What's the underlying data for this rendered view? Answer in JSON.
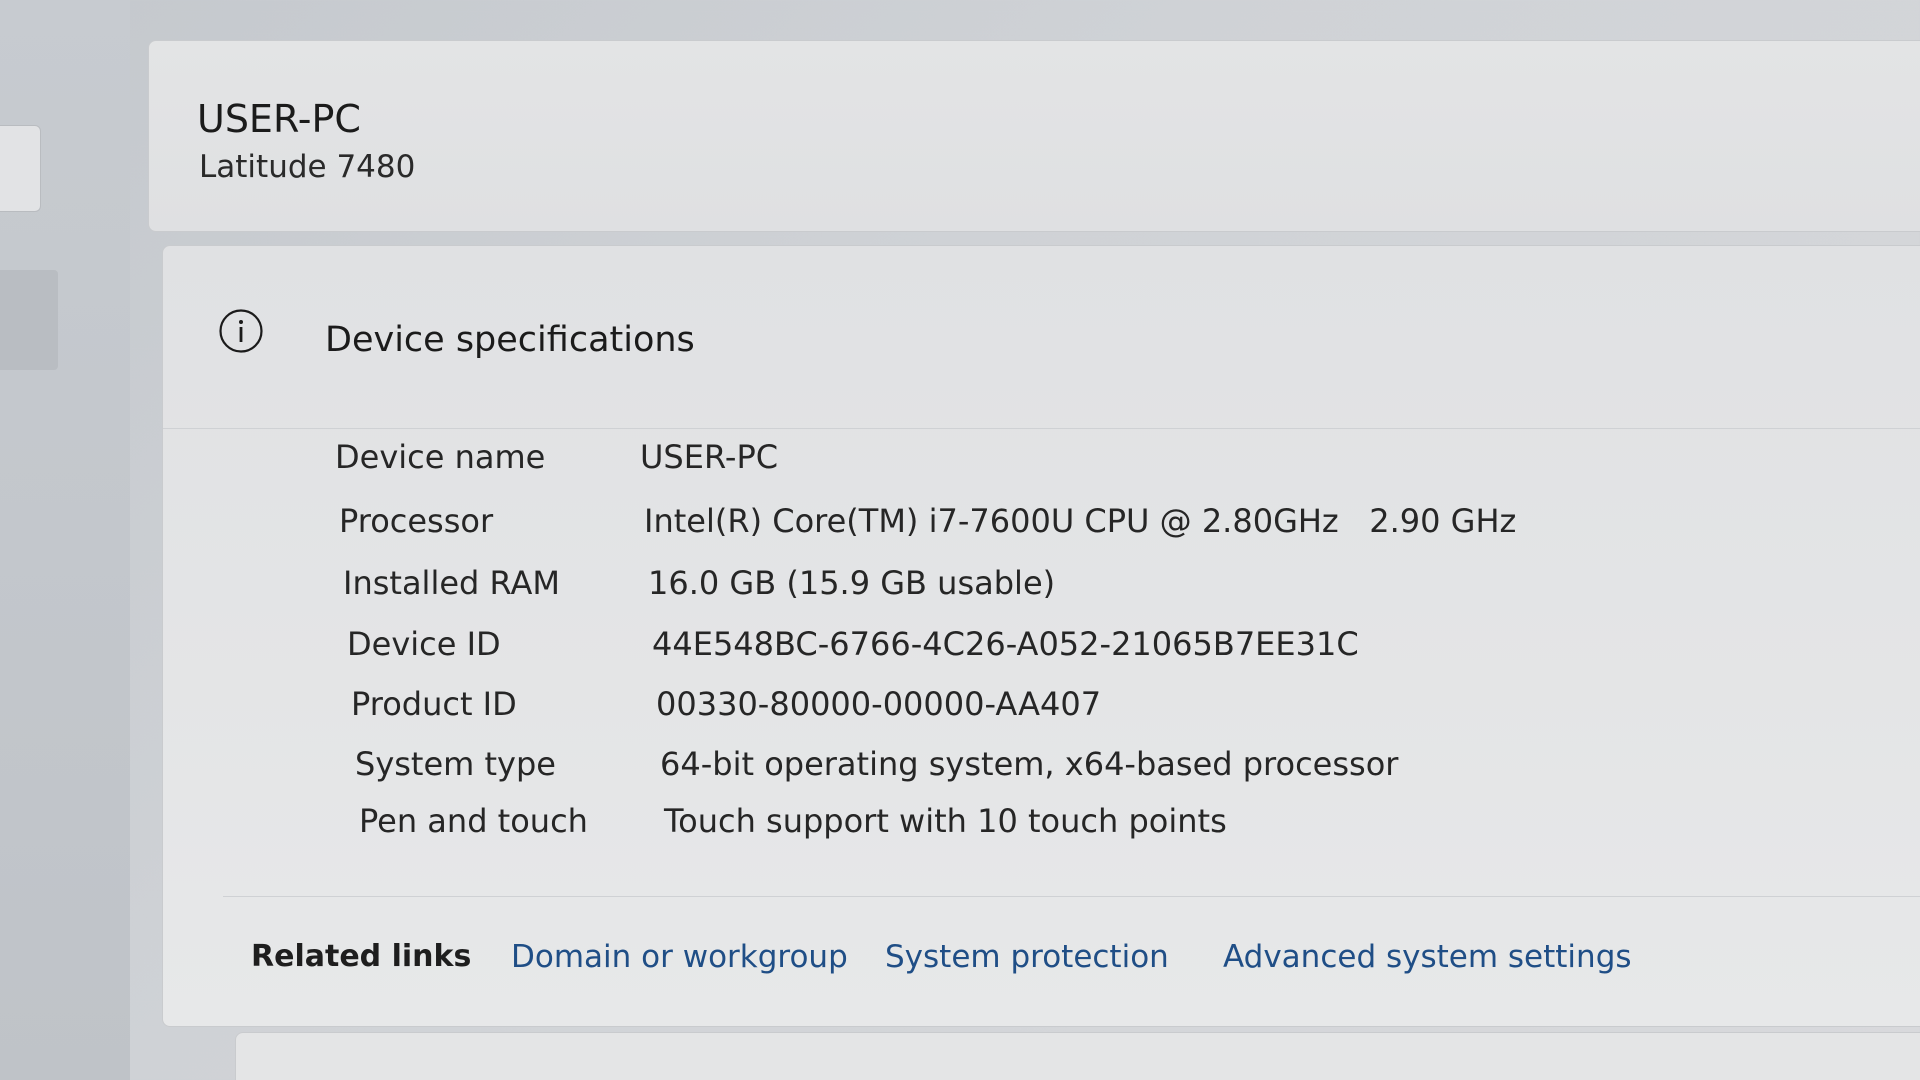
{
  "device": {
    "name": "USER-PC",
    "model": "Latitude 7480"
  },
  "specs": {
    "title": "Device specifications",
    "icon": "info-icon",
    "rows": [
      {
        "label": "Device name",
        "value": "USER-PC"
      },
      {
        "label": "Processor",
        "value": "Intel(R) Core(TM) i7-7600U CPU @ 2.80GHz   2.90 GHz"
      },
      {
        "label": "Installed RAM",
        "value": "16.0 GB (15.9 GB usable)"
      },
      {
        "label": "Device ID",
        "value": "44E548BC-6766-4C26-A052-21065B7EE31C"
      },
      {
        "label": "Product ID",
        "value": "00330-80000-00000-AA407"
      },
      {
        "label": "System type",
        "value": "64-bit operating system, x64-based processor"
      },
      {
        "label": "Pen and touch",
        "value": "Touch support with 10 touch points"
      }
    ]
  },
  "related": {
    "label": "Related links",
    "links": [
      "Domain or workgroup",
      "System protection",
      "Advanced system settings"
    ]
  },
  "colors": {
    "link": "#1f4e86",
    "text": "#1b1b1b",
    "card": "#e6e7e8"
  }
}
